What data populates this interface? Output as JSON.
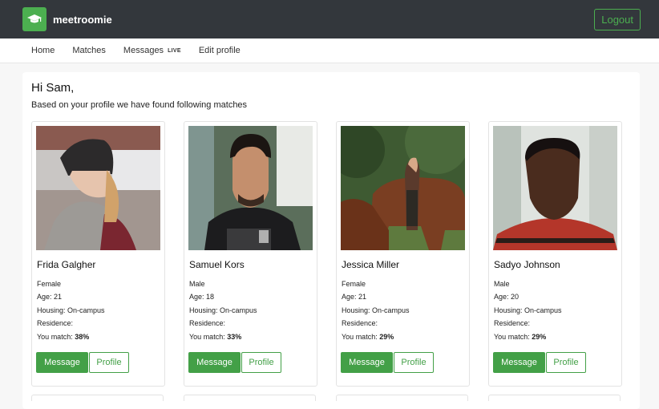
{
  "app": {
    "brand": "meetroomie",
    "logout_label": "Logout"
  },
  "nav": [
    {
      "label": "Home"
    },
    {
      "label": "Matches"
    },
    {
      "label": "Messages",
      "badge": "LIVE"
    },
    {
      "label": "Edit profile"
    }
  ],
  "main": {
    "greeting": "Hi Sam,",
    "subtitle": "Based on your profile we have found following matches"
  },
  "cards": [
    {
      "name": "Frida Galgher",
      "gender": "Female",
      "age": "Age: 21",
      "housing": "Housing: On-campus",
      "residence": "Residence:",
      "match_label": "You match:",
      "match_value": "38%",
      "message_label": "Message",
      "profile_label": "Profile"
    },
    {
      "name": "Samuel Kors",
      "gender": "Male",
      "age": "Age: 18",
      "housing": "Housing: On-campus",
      "residence": "Residence:",
      "match_label": "You match:",
      "match_value": "33%",
      "message_label": "Message",
      "profile_label": "Profile"
    },
    {
      "name": "Jessica Miller",
      "gender": "Female",
      "age": "Age: 21",
      "housing": "Housing: On-campus",
      "residence": "Residence:",
      "match_label": "You match:",
      "match_value": "29%",
      "message_label": "Message",
      "profile_label": "Profile"
    },
    {
      "name": "Sadyo Johnson",
      "gender": "Male",
      "age": "Age: 20",
      "housing": "Housing: On-campus",
      "residence": "Residence:",
      "match_label": "You match:",
      "match_value": "29%",
      "message_label": "Message",
      "profile_label": "Profile"
    }
  ],
  "colors": {
    "accent": "#43a047",
    "topbar": "#33373c"
  }
}
